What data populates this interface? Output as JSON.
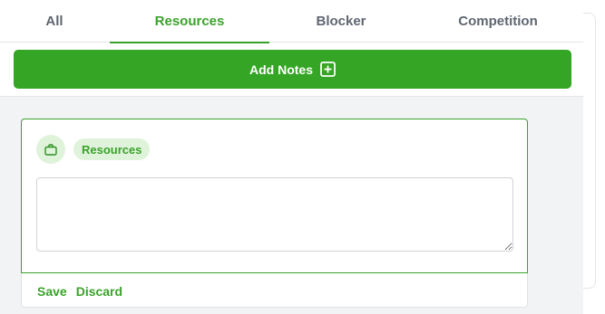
{
  "tabs": [
    {
      "label": "All"
    },
    {
      "label": "Resources"
    },
    {
      "label": "Blocker"
    },
    {
      "label": "Competition"
    }
  ],
  "active_tab": "Resources",
  "add_notes": {
    "label": "Add Notes",
    "icon": "plus-square-icon"
  },
  "note_card": {
    "category_icon": "briefcase-icon",
    "category_label": "Resources",
    "note_text": "",
    "save_label": "Save",
    "discard_label": "Discard"
  },
  "colors": {
    "accent": "#3aa22a",
    "button_bg": "#34a524",
    "pill_bg": "#dff3da",
    "tab_inactive": "#5f6670",
    "page_bg": "#f2f3f5"
  }
}
